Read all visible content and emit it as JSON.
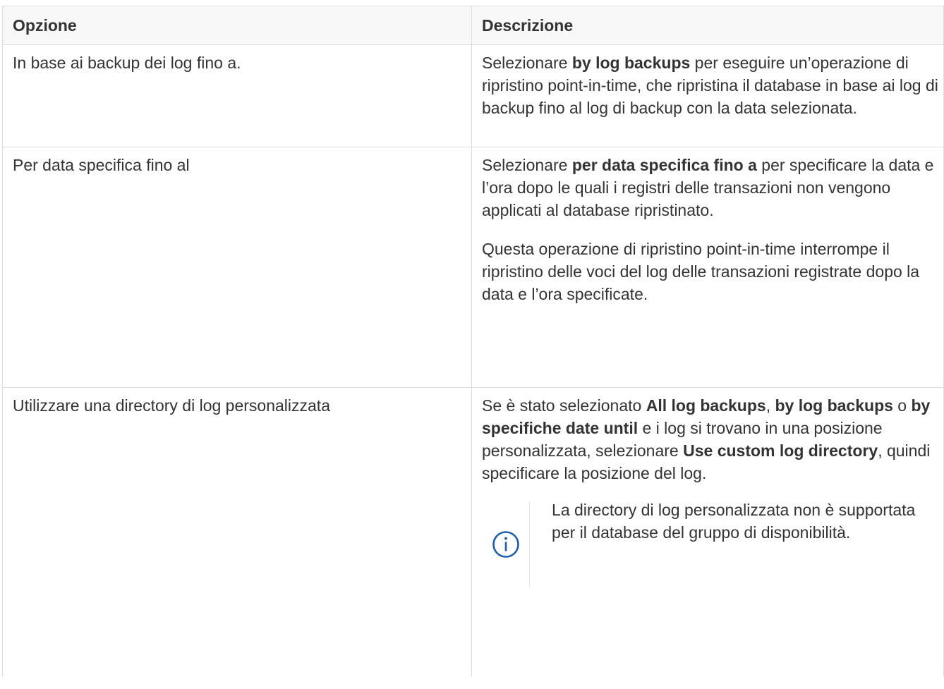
{
  "table": {
    "headers": [
      "Opzione",
      "Descrizione"
    ],
    "rows": [
      {
        "option": "In base ai backup dei log fino a.",
        "desc": {
          "p1_a": "Selezionare ",
          "p1_b": "by log backups",
          "p1_c": " per eseguire un’operazione di ripristino point-in-time, che ripristina il database in base ai log di backup fino al log di backup con la data selezionata."
        }
      },
      {
        "option": "Per data specifica fino al",
        "desc": {
          "p1_a": "Selezionare ",
          "p1_b": "per data specifica fino a",
          "p1_c": " per specificare la data e l’ora dopo le quali i registri delle transazioni non vengono applicati al database ripristinato.",
          "p2": "Questa operazione di ripristino point-in-time interrompe il ripristino delle voci del log delle transazioni registrate dopo la data e l’ora specificate."
        }
      },
      {
        "option": "Utilizzare una directory di log personalizzata",
        "desc": {
          "s1": "Se è stato selezionato ",
          "b1": "All log backups",
          "s2": ", ",
          "b2": "by log backups",
          "s3": " o ",
          "b3": "by specifiche date until",
          "s4": " e i log si trovano in una posizione personalizzata, selezionare ",
          "b4": "Use custom log directory",
          "s5": ", quindi specificare la posizione del log."
        },
        "note": {
          "icon": "info-circle-icon",
          "text": "La directory di log personalizzata non è supportata per il database del gruppo di disponibilità."
        }
      }
    ]
  },
  "colors": {
    "text": "#333333",
    "header_bg": "#f7f8f7",
    "border": "#dcdcdc",
    "icon": "#1c5ea8"
  }
}
